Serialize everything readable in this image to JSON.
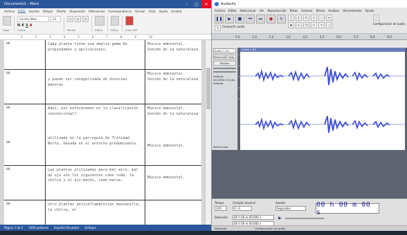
{
  "word": {
    "title": "Documento1 - Word",
    "menu": [
      "Archivo",
      "Inicio",
      "Insertar",
      "Dibujar",
      "Diseño",
      "Disposición",
      "Referencias",
      "Correspondencia",
      "Revisar",
      "Vista",
      "Ayuda",
      "Acrobat"
    ],
    "active_menu": "Inicio",
    "ribbon": {
      "font_name": "Courier New",
      "font_size": "12",
      "groups": [
        "Portapapeles",
        "Fuente",
        "Párrafo",
        "Estilos",
        "Edición",
        "Crear y compartir"
      ],
      "paste_label": "Pegar",
      "styles_label": "Estilos",
      "edit_label": "Editar",
      "pdf_label": "Crear PDF"
    },
    "ruler_marks": [
      "1",
      "2",
      "3",
      "4",
      "5",
      "6",
      "7",
      "8",
      "9",
      "10"
    ],
    "rows": [
      {
        "c1": "00",
        "c2": "Cada planta tiene una amplia gama de propiedades y aplicaciones,",
        "c3": "Música ambiental. Sonido de la naturaleza"
      },
      {
        "c1": "00",
        "c2": "y puede ser categorizada de diversas maneras.",
        "c3": "Música ambiental. Sonido de la naturaleza"
      },
      {
        "c1": "00",
        "c2": "Aquí, nos enfocaremos en la clasificación convencional?",
        "c3": "Música ambiental. Sonido de la naturaleza"
      },
      {
        "c1": "00",
        "c2": "utilizada en la parroquia de Trinidad Norte, basada en el entorno predominante.",
        "c3": "Música ambiental."
      },
      {
        "c1": "00",
        "c2": "Las plantas utilizadas para mal aire, mal de ojo son los siguientes como ruda, la chilca y el ajo macho, como malva.",
        "c3": "Música ambiental."
      },
      {
        "c1": "00",
        "c2": "otro plantas antiinflamatorias manzanilla, la chilca, el",
        "c3": ""
      }
    ],
    "status": [
      "Página 1 de 2",
      "1065 palabras",
      "Español (Ecuador)",
      "Enfoque"
    ]
  },
  "audacity": {
    "title": "Audacity",
    "menu": [
      "Archivo",
      "Editar",
      "Seleccionar",
      "Ver",
      "Reproducción",
      "Pistas",
      "Generar",
      "Efecto",
      "Analizar",
      "Herramientas",
      "Ayuda"
    ],
    "audio_setup": "Configuración de audio",
    "share_audio": "Compartir audio",
    "timeline_marks": [
      "0.0",
      "1.0",
      "2.0",
      "3.0",
      "4.0",
      "5.0",
      "6.0",
      "7.0",
      "8.0",
      "9.0"
    ],
    "track": {
      "name": "Audio 1 #1",
      "clip_name": "Audio 1 #1",
      "mute": "Silenciar",
      "solo": "Solo",
      "effects": "Efectos",
      "info": "Estéreo, 44100Hz 32 bits flotante",
      "select": "Seleccionar",
      "scale_labels": [
        "1.0",
        "0.5",
        "0.0",
        "-0.5",
        "-1.0"
      ]
    },
    "bottom": {
      "tempo_label": "Tempo",
      "tempo_value": "120",
      "time_signature_label": "Compás musical",
      "time_signature": "4 / 4",
      "snap_label": "Ajustar",
      "snap_value": "Segundos",
      "time_display": "00 h 00 m 00 s",
      "selection_label": "Selección",
      "selection_start": "00 h 00 m 00.000 s",
      "selection_end": "00 h 00 m 00.000 s"
    },
    "status": [
      "Detenido.",
      "Configuración de audio"
    ]
  }
}
